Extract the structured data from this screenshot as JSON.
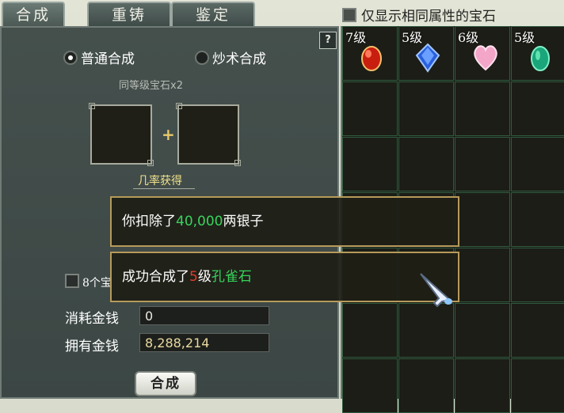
{
  "tabs": [
    {
      "label": "合成",
      "active": true
    },
    {
      "label": "重铸",
      "active": false
    },
    {
      "label": "鉴定",
      "active": false
    }
  ],
  "filter": {
    "label": "仅显示相同属性的宝石",
    "checked": false
  },
  "help": {
    "label": "?"
  },
  "modes": [
    {
      "label": "普通合成",
      "selected": true
    },
    {
      "label": "炒术合成",
      "selected": false
    }
  ],
  "hint": "同等级宝石x2",
  "plus": "+",
  "rate_label": "几率获得",
  "auto_checkbox_label": "8个宝",
  "cost": {
    "label": "消耗金钱",
    "value": "0"
  },
  "owned": {
    "label": "拥有金钱",
    "value": "8,288,214"
  },
  "compose_button": "合成",
  "inventory": [
    {
      "level": "7级",
      "gem": "red-ruby"
    },
    {
      "level": "5级",
      "gem": "blue-sapphire"
    },
    {
      "level": "6级",
      "gem": "pink-heart"
    },
    {
      "level": "5级",
      "gem": "green-peacock"
    }
  ],
  "messages": [
    {
      "prefix": "你扣除了",
      "amount": "40,000",
      "suffix": "两银子"
    },
    {
      "prefix": "成功合成了",
      "level": "5",
      "level_suffix": "级",
      "item": "孔雀石"
    }
  ],
  "colors": {
    "accent_gold": "#b69a5a",
    "money_green": "#37d45c",
    "level_red": "#e53c2a"
  }
}
